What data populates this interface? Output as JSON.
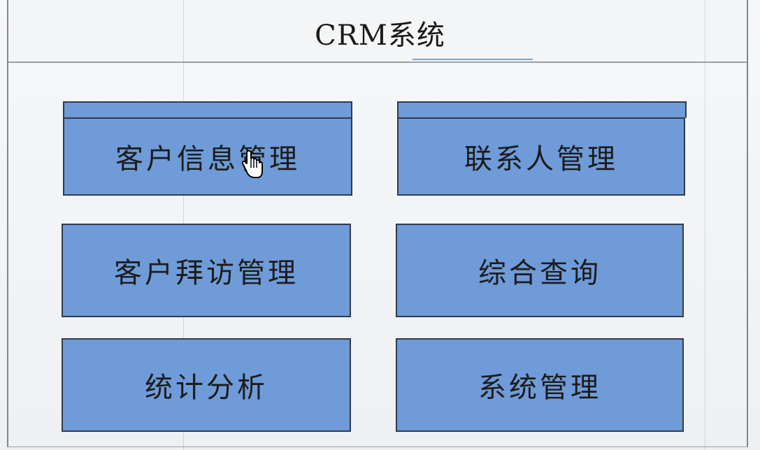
{
  "title": "CRM系统",
  "modules": [
    {
      "label": "客户信息管理"
    },
    {
      "label": "联系人管理"
    },
    {
      "label": "客户拜访管理"
    },
    {
      "label": "综合查询"
    },
    {
      "label": "统计分析"
    },
    {
      "label": "系统管理"
    }
  ],
  "colors": {
    "box_fill": "#6f9bd8",
    "box_border": "#2e3b4e",
    "background": "#f3f4f6"
  }
}
